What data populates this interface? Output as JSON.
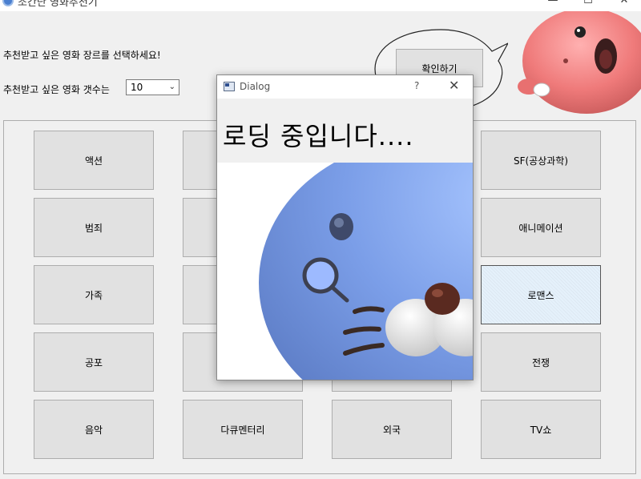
{
  "window": {
    "title": "조간단 영화추천기",
    "minimize_glyph": "—",
    "maximize_glyph": "☐",
    "close_glyph": "✕"
  },
  "form": {
    "genre_prompt": "추천받고 싶은 영화 장르를 선택하세요!",
    "count_prompt": "추천받고 싶은 영화 갯수는",
    "count_selected": "10",
    "confirm_label": "확인하기"
  },
  "genres": [
    {
      "label": "액션"
    },
    {
      "label": ""
    },
    {
      "label": ""
    },
    {
      "label": "SF(공상과학)"
    },
    {
      "label": "범죄"
    },
    {
      "label": ""
    },
    {
      "label": ""
    },
    {
      "label": "애니메이션"
    },
    {
      "label": "가족"
    },
    {
      "label": ""
    },
    {
      "label": ""
    },
    {
      "label": "로맨스",
      "selected": true
    },
    {
      "label": "공포"
    },
    {
      "label": ""
    },
    {
      "label": ""
    },
    {
      "label": "전쟁"
    },
    {
      "label": "음악"
    },
    {
      "label": "다큐멘터리"
    },
    {
      "label": "외국"
    },
    {
      "label": "TV쇼"
    }
  ],
  "dialog": {
    "title": "Dialog",
    "help_glyph": "?",
    "close_glyph": "✕",
    "message": "로딩 중입니다....",
    "image": "blue-cartoon-character-with-magnifier"
  },
  "icons": {
    "app": "app-icon",
    "mascot": "pink-cartoon-mascot",
    "bubble": "speech-bubble"
  },
  "colors": {
    "window_bg": "#f0f0f0",
    "button_bg": "#e1e1e1",
    "button_border": "#adadad",
    "dialog_message_bg": "#f0f0f0",
    "character_blue": "#7b9ee8",
    "mascot_pink": "#ef7a7a"
  }
}
